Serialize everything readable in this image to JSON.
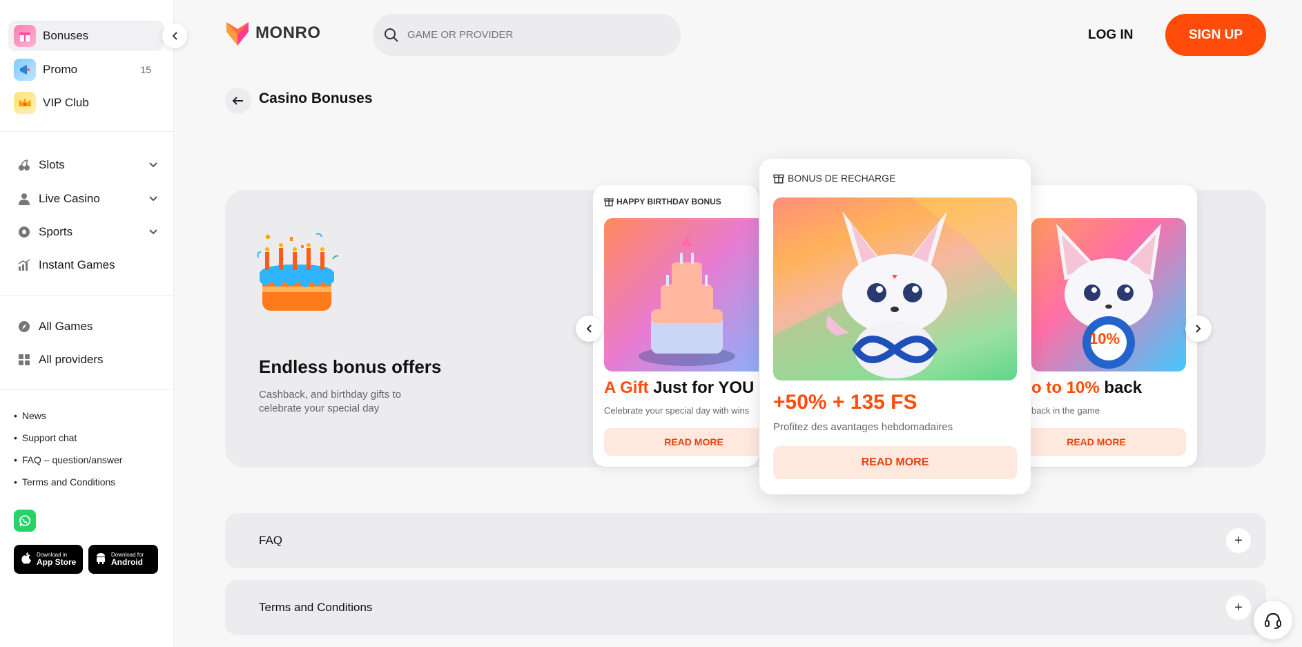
{
  "sidebar": {
    "top_items": [
      {
        "label": "Bonuses",
        "icon": "gift-icon"
      },
      {
        "label": "Promo",
        "icon": "megaphone-icon",
        "count": "15"
      },
      {
        "label": "VIP Club",
        "icon": "crown-icon"
      }
    ],
    "nav_items": [
      {
        "label": "Slots",
        "icon": "cherry-icon"
      },
      {
        "label": "Live Casino",
        "icon": "dealer-icon"
      },
      {
        "label": "Sports",
        "icon": "ball-icon"
      },
      {
        "label": "Instant Games",
        "icon": "chart-icon"
      }
    ],
    "game_items": [
      {
        "label": "All Games",
        "icon": "compass-icon"
      },
      {
        "label": "All providers",
        "icon": "grid-icon"
      }
    ],
    "links": [
      "News",
      "Support chat",
      "FAQ – question/answer",
      "Terms and Conditions"
    ],
    "app_store": {
      "small": "Download in",
      "big": "App Store"
    },
    "android": {
      "small": "Download for",
      "big": "Android"
    }
  },
  "header": {
    "logo": "MONRO",
    "search_placeholder": "GAME OR PROVIDER",
    "login": "LOG IN",
    "signup": "SIGN UP"
  },
  "page": {
    "title": "Casino Bonuses"
  },
  "hero": {
    "title": "Endless bonus offers",
    "subtitle": "Cashback, and birthday gifts to celebrate your special day"
  },
  "cards": {
    "left": {
      "tag": "HAPPY BIRTHDAY BONUS",
      "title_hl": "A Gift",
      "title_rest": " Just for YOU",
      "subtitle": "Celebrate your special day with wins",
      "button": "READ MORE"
    },
    "center": {
      "tag": "BONUS DE RECHARGE",
      "title": "+50% + 135 FS",
      "subtitle": "Profitez des avantages hebdomadaires",
      "button": "READ MORE"
    },
    "right": {
      "title_hl": "o to 10%",
      "title_rest": " back",
      "subtitle": "back in the game",
      "badge": "10%",
      "button": "READ MORE"
    }
  },
  "accordions": [
    "FAQ",
    "Terms and Conditions"
  ],
  "colors": {
    "accent": "#ff4c0a",
    "accent_light": "#ffe9df"
  }
}
